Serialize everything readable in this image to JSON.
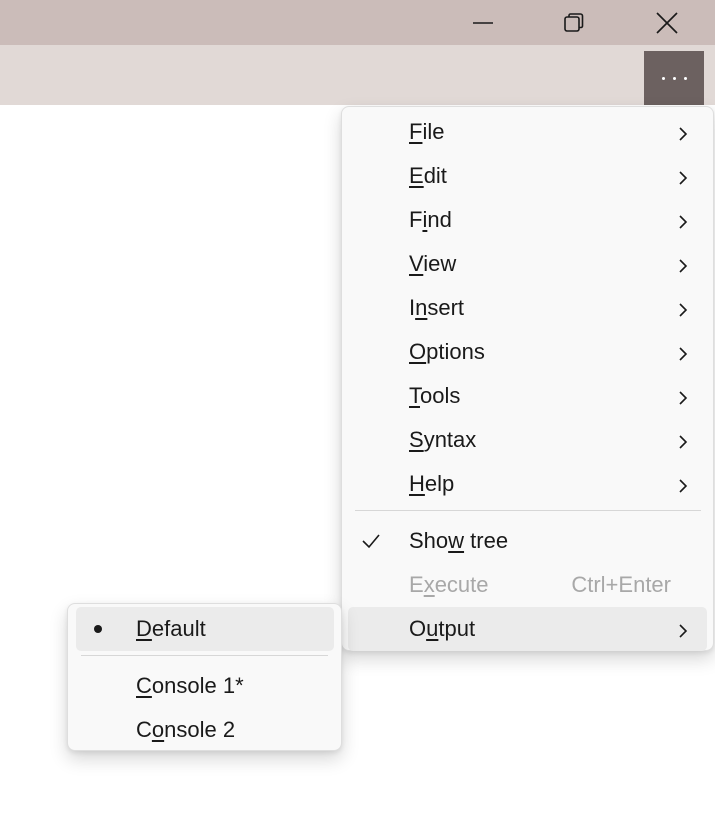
{
  "window_controls": {
    "minimize_icon": "minimize-icon",
    "restore_icon": "restore-icon",
    "close_icon": "close-icon"
  },
  "toolbar": {
    "more_icon": "more-ellipsis-icon"
  },
  "main_menu": {
    "items": [
      {
        "pre": "",
        "u": "F",
        "post": "ile",
        "has_submenu": true
      },
      {
        "pre": "",
        "u": "E",
        "post": "dit",
        "has_submenu": true
      },
      {
        "pre": "F",
        "u": "i",
        "post": "nd",
        "has_submenu": true
      },
      {
        "pre": "",
        "u": "V",
        "post": "iew",
        "has_submenu": true
      },
      {
        "pre": "I",
        "u": "n",
        "post": "sert",
        "has_submenu": true
      },
      {
        "pre": "",
        "u": "O",
        "post": "ptions",
        "has_submenu": true
      },
      {
        "pre": "",
        "u": "T",
        "post": "ools",
        "has_submenu": true
      },
      {
        "pre": "",
        "u": "S",
        "post": "yntax",
        "has_submenu": true
      },
      {
        "pre": "",
        "u": "H",
        "post": "elp",
        "has_submenu": true
      }
    ],
    "show_tree": {
      "pre": "Sho",
      "u": "w",
      "post": " tree",
      "checked": true
    },
    "execute": {
      "pre": "E",
      "u": "x",
      "post": "ecute",
      "shortcut": "Ctrl+Enter",
      "enabled": false
    },
    "output": {
      "pre": "O",
      "u": "u",
      "post": "tput",
      "has_submenu": true
    }
  },
  "output_submenu": {
    "default": {
      "pre": "",
      "u": "D",
      "post": "efault",
      "selected": true
    },
    "console1": {
      "pre": "",
      "u": "C",
      "post": "onsole 1*"
    },
    "console2": {
      "pre": "C",
      "u": "o",
      "post": "nsole 2"
    }
  },
  "colors": {
    "titlebar": "#cbbcb9",
    "toolbar": "#e1d9d6",
    "more_button": "#6c6160",
    "menu_bg": "#f9f9f9",
    "disabled_text": "#a8a8a8"
  }
}
